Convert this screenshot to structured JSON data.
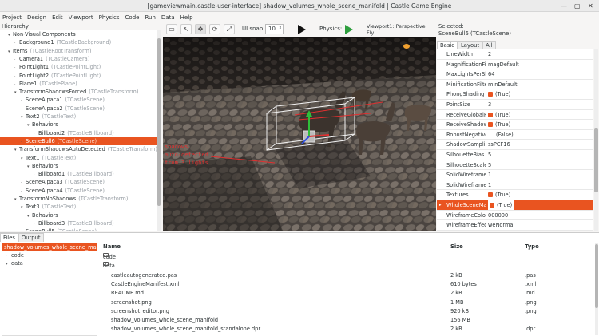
{
  "window": {
    "title": "[gameviewmain.castle-user-interface] shadow_volumes_whole_scene_manifold | Castle Game Engine"
  },
  "menu": [
    "Project",
    "Design",
    "Edit",
    "Viewport",
    "Physics",
    "Code",
    "Run",
    "Data",
    "Help"
  ],
  "hierarchy": {
    "label": "Hierarchy",
    "items": [
      {
        "name": "Non-Visual Components",
        "cls": "",
        "depth": 1,
        "tw": "▾"
      },
      {
        "name": "Background1",
        "cls": "(TCastleBackground)",
        "depth": 2,
        "tw": ""
      },
      {
        "name": "Items",
        "cls": "(TCastleRootTransform)",
        "depth": 1,
        "tw": "▾"
      },
      {
        "name": "Camera1",
        "cls": "(TCastleCamera)",
        "depth": 2,
        "tw": ""
      },
      {
        "name": "PointLight1",
        "cls": "(TCastlePointLight)",
        "depth": 2,
        "tw": ""
      },
      {
        "name": "PointLight2",
        "cls": "(TCastlePointLight)",
        "depth": 2,
        "tw": ""
      },
      {
        "name": "Plane1",
        "cls": "(TCastlePlane)",
        "depth": 2,
        "tw": ""
      },
      {
        "name": "TransformShadowsForced",
        "cls": "(TCastleTransform)",
        "depth": 2,
        "tw": "▾"
      },
      {
        "name": "SceneAlpaca1",
        "cls": "(TCastleScene)",
        "depth": 3,
        "tw": ""
      },
      {
        "name": "SceneAlpaca2",
        "cls": "(TCastleScene)",
        "depth": 3,
        "tw": ""
      },
      {
        "name": "Text2",
        "cls": "(TCastleText)",
        "depth": 3,
        "tw": "▾"
      },
      {
        "name": "Behaviors",
        "cls": "",
        "depth": 4,
        "tw": "▾"
      },
      {
        "name": "Billboard2",
        "cls": "(TCastleBillboard)",
        "depth": 5,
        "tw": ""
      },
      {
        "name": "SceneBull6",
        "cls": "(TCastleScene)",
        "depth": 3,
        "tw": "",
        "selected": true
      },
      {
        "name": "TransformShadowsAutoDetected",
        "cls": "(TCastleTransform)",
        "depth": 2,
        "tw": "▾"
      },
      {
        "name": "Text1",
        "cls": "(TCastleText)",
        "depth": 3,
        "tw": "▾"
      },
      {
        "name": "Behaviors",
        "cls": "",
        "depth": 4,
        "tw": "▾"
      },
      {
        "name": "Billboard1",
        "cls": "(TCastleBillboard)",
        "depth": 5,
        "tw": ""
      },
      {
        "name": "SceneAlpaca3",
        "cls": "(TCastleScene)",
        "depth": 3,
        "tw": ""
      },
      {
        "name": "SceneAlpaca4",
        "cls": "(TCastleScene)",
        "depth": 3,
        "tw": ""
      },
      {
        "name": "TransformNoShadows",
        "cls": "(TCastleTransform)",
        "depth": 2,
        "tw": "▾"
      },
      {
        "name": "Text3",
        "cls": "(TCastleText)",
        "depth": 3,
        "tw": "▾"
      },
      {
        "name": "Behaviors",
        "cls": "",
        "depth": 4,
        "tw": "▾"
      },
      {
        "name": "Billboard3",
        "cls": "(TCastleBillboard)",
        "depth": 5,
        "tw": ""
      },
      {
        "name": "SceneBull5",
        "cls": "(TCastleScene)",
        "depth": 3,
        "tw": ""
      }
    ]
  },
  "toolbar": {
    "ui_snap_label": "UI snap:",
    "ui_snap_value": "10",
    "physics_label": "Physics:"
  },
  "viewport": {
    "label_line1": "Viewport1: Perspective",
    "label_line2": "Fly"
  },
  "inspector": {
    "selected_line1": "Selected:",
    "selected_line2": "SceneBull6 (TCastleScene)",
    "tabs": [
      "Basic",
      "Layout",
      "All"
    ],
    "active_tab": "Basic",
    "properties": [
      {
        "name": "LineWidth",
        "value": "2",
        "check": false
      },
      {
        "name": "MagnificationFilter",
        "value": "magDefault",
        "check": false
      },
      {
        "name": "MaxLightsPerShape",
        "value": "64",
        "check": false
      },
      {
        "name": "MinificationFilter",
        "value": "minDefault",
        "check": false
      },
      {
        "name": "PhongShading",
        "value": "(True)",
        "check": true
      },
      {
        "name": "PointSize",
        "value": "3",
        "check": false
      },
      {
        "name": "ReceiveGlobalFog",
        "value": "(True)",
        "check": true
      },
      {
        "name": "ReceiveShadowVolumes",
        "value": "(True)",
        "check": true
      },
      {
        "name": "RobustNegativeScale",
        "value": "(False)",
        "check": false,
        "indent": true
      },
      {
        "name": "ShadowSampling",
        "value": "ssPCF16",
        "check": false
      },
      {
        "name": "SilhouetteBias",
        "value": "5",
        "check": false
      },
      {
        "name": "SilhouetteScale",
        "value": "5",
        "check": false
      },
      {
        "name": "SolidWireframeBias",
        "value": "1",
        "check": false
      },
      {
        "name": "SolidWireframeScale",
        "value": "1",
        "check": false
      },
      {
        "name": "Textures",
        "value": "(True)",
        "check": true
      },
      {
        "name": "WholeSceneManifold",
        "value": "(True)",
        "check": true,
        "selected": true
      },
      {
        "name": "WireframeColor",
        "value": "000000",
        "check": false
      },
      {
        "name": "WireframeEffect",
        "value": "weNormal",
        "check": false
      }
    ]
  },
  "bottom": {
    "tabs": [
      "Files",
      "Output"
    ],
    "active_tab": "Files",
    "folders": [
      {
        "name": "shadow_volumes_whole_scene_manifold",
        "selected": true
      },
      {
        "name": "code",
        "tw": ""
      },
      {
        "name": "data",
        "tw": "▸"
      }
    ],
    "columns": {
      "name": "Name",
      "size": "Size",
      "type": "Type"
    },
    "files": [
      {
        "name": "code",
        "size": "",
        "type": "",
        "folder": true
      },
      {
        "name": "data",
        "size": "",
        "type": "",
        "folder": true
      },
      {
        "name": "castleautogenerated.pas",
        "size": "2 kB",
        "type": ".pas"
      },
      {
        "name": "CastleEngineManifest.xml",
        "size": "610 bytes",
        "type": ".xml"
      },
      {
        "name": "README.md",
        "size": "2 kB",
        "type": ".md"
      },
      {
        "name": "screenshot.png",
        "size": "1 MB",
        "type": ".png"
      },
      {
        "name": "screenshot_editor.png",
        "size": "920 kB",
        "type": ".png"
      },
      {
        "name": "shadow_volumes_whole_scene_manifold",
        "size": "156 MB",
        "type": ""
      },
      {
        "name": "shadow_volumes_whole_scene_manifold_standalone.dpr",
        "size": "2 kB",
        "type": ".dpr"
      }
    ]
  },
  "colors": {
    "accent": "#e95420",
    "play": "#1a1a1a",
    "physics_play": "#2e9e3e"
  }
}
